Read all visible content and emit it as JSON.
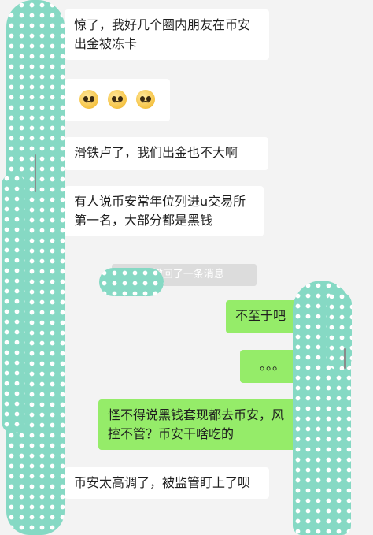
{
  "chat": {
    "messages": [
      {
        "id": 1,
        "side": "in",
        "text": "惊了，我好几个圈内朋友在币安出金被冻卡"
      },
      {
        "id": 2,
        "side": "in",
        "emojis": [
          "pleading-face",
          "pleading-face",
          "pleading-face"
        ]
      },
      {
        "id": 3,
        "side": "in",
        "text": "滑铁卢了，我们出金也不大啊"
      },
      {
        "id": 4,
        "side": "in",
        "text": "有人说币安常年位列进u交易所第一名，大部分都是黑钱"
      },
      {
        "id": 6,
        "side": "out",
        "text": "不至于吧"
      },
      {
        "id": 7,
        "side": "out",
        "text": "。。。"
      },
      {
        "id": 8,
        "side": "out",
        "text": "怪不得说黑钱套现都去币安，风控不管？币安干啥吃的"
      },
      {
        "id": 9,
        "side": "in",
        "text": "币安太高调了，被监管盯上了呗"
      }
    ],
    "recall": {
      "name": "”",
      "text": "撤回了一条消息"
    }
  },
  "colors": {
    "background": "#f3f3f3",
    "incoming_bubble": "#ffffff",
    "outgoing_bubble": "#95ec69",
    "mask": "#86d9c4"
  }
}
